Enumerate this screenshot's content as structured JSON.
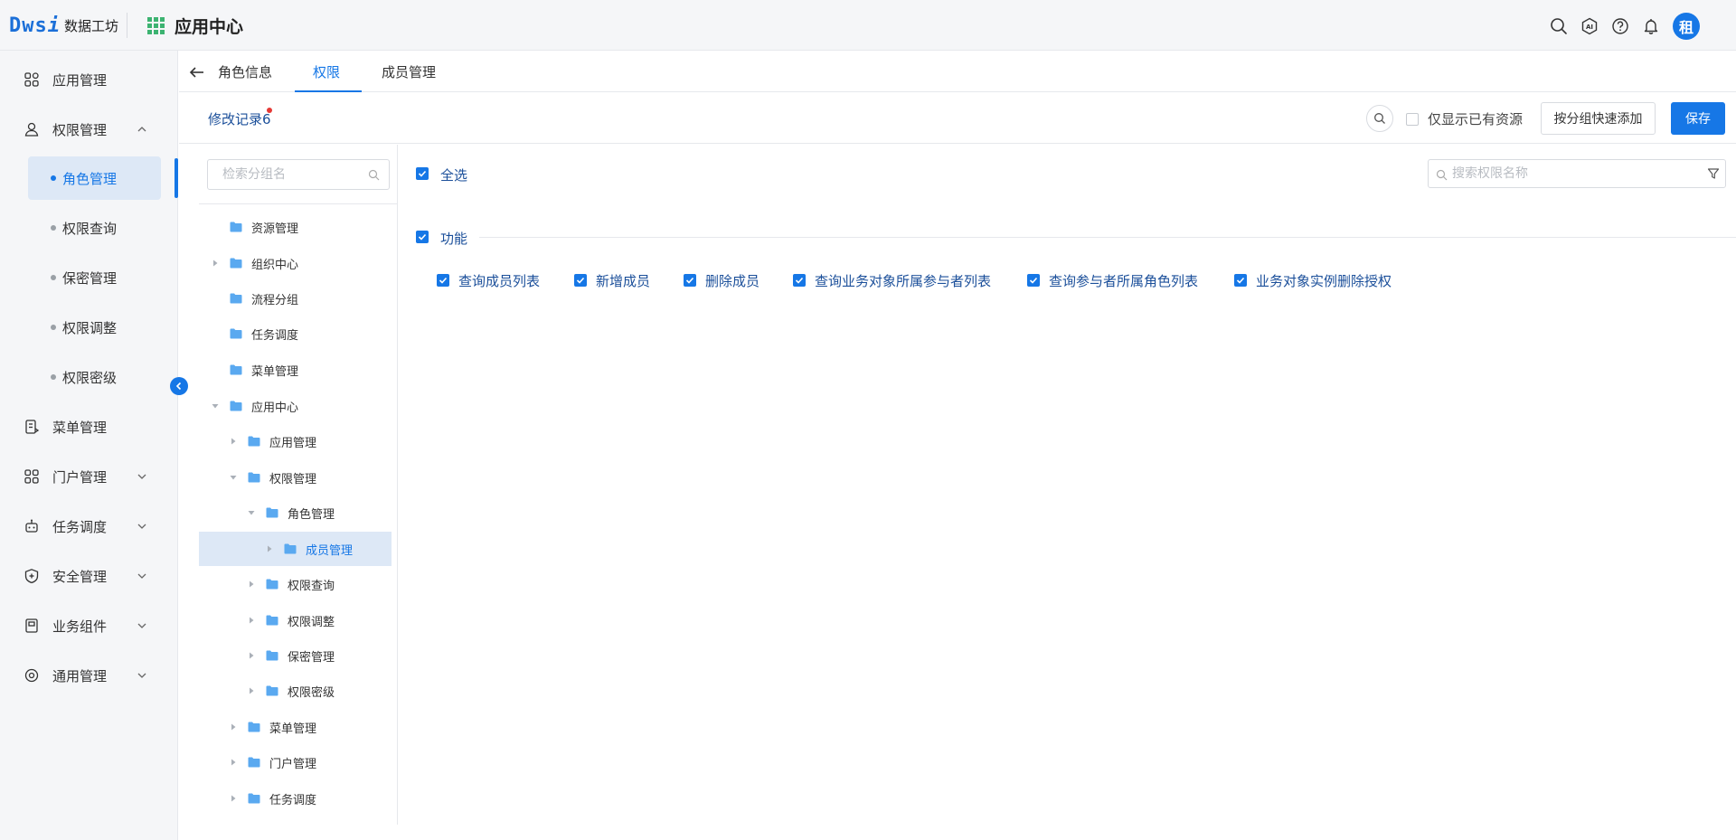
{
  "header": {
    "logo_mark": "Dws",
    "logo_mark_i": "i",
    "logo_text": "数据工坊",
    "app_center_title": "应用中心",
    "avatar_text": "租"
  },
  "sidebar": {
    "items": [
      {
        "label": "应用管理"
      },
      {
        "label": "权限管理"
      },
      {
        "label": "菜单管理"
      },
      {
        "label": "门户管理"
      },
      {
        "label": "任务调度"
      },
      {
        "label": "安全管理"
      },
      {
        "label": "业务组件"
      },
      {
        "label": "通用管理"
      }
    ],
    "sub_items": [
      {
        "label": "角色管理",
        "active": true
      },
      {
        "label": "权限查询"
      },
      {
        "label": "保密管理"
      },
      {
        "label": "权限调整"
      },
      {
        "label": "权限密级"
      }
    ]
  },
  "tabs": [
    {
      "label": "角色信息"
    },
    {
      "label": "权限",
      "active": true
    },
    {
      "label": "成员管理"
    }
  ],
  "toolbar": {
    "history_label": "修改记录6",
    "only_existing_label": "仅显示已有资源",
    "quick_add_label": "按分组快速添加",
    "save_label": "保存"
  },
  "tree": {
    "search_placeholder": "检索分组名",
    "rows": [
      {
        "label": "资源管理"
      },
      {
        "label": "组织中心"
      },
      {
        "label": "流程分组"
      },
      {
        "label": "任务调度"
      },
      {
        "label": "菜单管理"
      },
      {
        "label": "应用中心"
      },
      {
        "label": "应用管理"
      },
      {
        "label": "权限管理"
      },
      {
        "label": "角色管理"
      },
      {
        "label": "成员管理"
      },
      {
        "label": "权限查询"
      },
      {
        "label": "权限调整"
      },
      {
        "label": "保密管理"
      },
      {
        "label": "权限密级"
      },
      {
        "label": "菜单管理"
      },
      {
        "label": "门户管理"
      },
      {
        "label": "任务调度"
      }
    ]
  },
  "content": {
    "select_all_label": "全选",
    "search_placeholder": "搜索权限名称",
    "group_label": "功能",
    "permissions": [
      {
        "label": "查询成员列表"
      },
      {
        "label": "新增成员"
      },
      {
        "label": "删除成员"
      },
      {
        "label": "查询业务对象所属参与者列表"
      },
      {
        "label": "查询参与者所属角色列表"
      },
      {
        "label": "业务对象实例删除授权"
      }
    ]
  },
  "colors": {
    "accent": "#1677e6",
    "link_text": "#1b4f9a",
    "selected_bg": "#dde8f6",
    "folder": "#5aa9f0",
    "badge_red": "#e53935"
  }
}
